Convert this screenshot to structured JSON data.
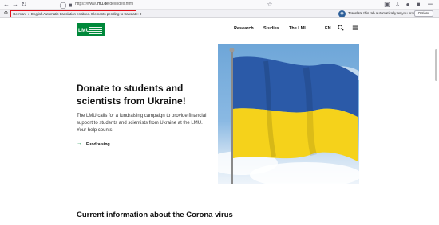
{
  "browser": {
    "url_prefix": "https://www.",
    "url_host": "lmu.de",
    "url_suffix": "/de/index.html"
  },
  "translation_bar": {
    "from_language": "German",
    "to_language": "English",
    "status": "Automatic translation enabled. Elements pending to translate: 0",
    "auto_translate_label": "Translate this tab automatically as you browse",
    "options_label": "Options"
  },
  "site": {
    "logo_text": "LMU",
    "nav": {
      "research": "Research",
      "studies": "Studies",
      "the_lmu": "The LMU",
      "language": "EN"
    }
  },
  "hero": {
    "title": "Donate to students and scientists from Ukraine!",
    "body": "The LMU calls for a fundraising campaign to provide financial support to students and scientists from Ukraine at the LMU. Your help counts!",
    "link_label": "Fundraising",
    "image_alt": "Ukrainian flag"
  },
  "next_section": {
    "heading": "Current information about the Corona virus"
  },
  "colors": {
    "brand_green": "#00883a",
    "flag_blue": "#2b5aa8",
    "flag_yellow": "#f5d21b",
    "highlight_red": "#e0101a"
  }
}
